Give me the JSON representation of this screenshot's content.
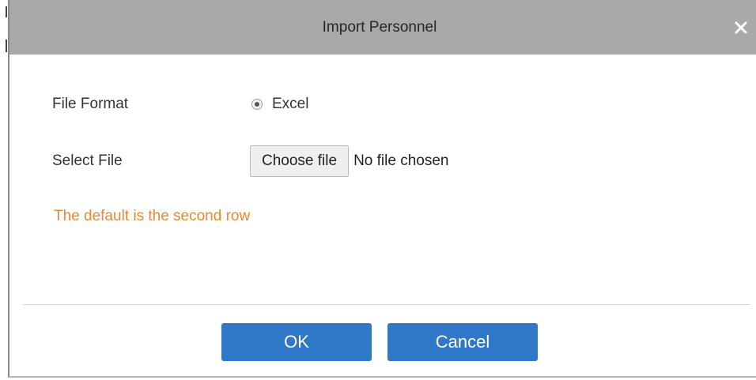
{
  "dialog": {
    "title": "Import Personnel",
    "close_icon": "close-icon"
  },
  "form": {
    "file_format_label": "File Format",
    "file_format_option": "Excel",
    "file_format_selected": true,
    "select_file_label": "Select File",
    "choose_file_button": "Choose file",
    "file_status": "No file chosen"
  },
  "hint": {
    "text": "The default is the second row",
    "color": "#e68a2e"
  },
  "footer": {
    "ok_label": "OK",
    "cancel_label": "Cancel",
    "button_color": "#2f77c7"
  }
}
